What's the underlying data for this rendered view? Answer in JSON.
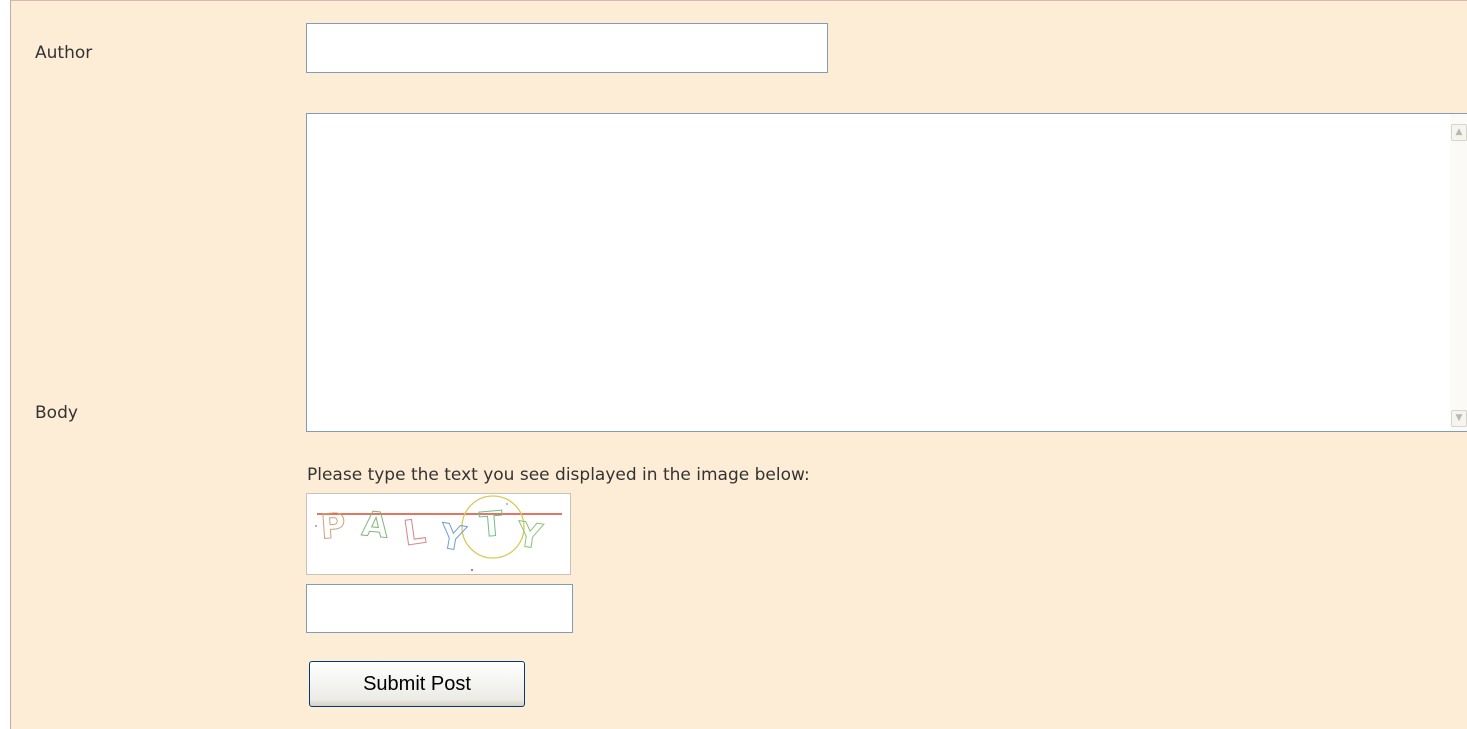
{
  "form": {
    "author_label": "Author",
    "author_value": "",
    "body_label": "Body",
    "body_value": "",
    "captcha_prompt": "Please type the text you see displayed in the image below:",
    "captcha_image_text": "PALYTY",
    "captcha_value": "",
    "submit_label": "Submit Post"
  },
  "icons": {
    "scroll_up": "chevron-up-icon",
    "scroll_down": "chevron-down-icon"
  },
  "colors": {
    "panel_background": "#feedd6",
    "input_border": "#7f9db9",
    "button_border": "#003c74"
  }
}
